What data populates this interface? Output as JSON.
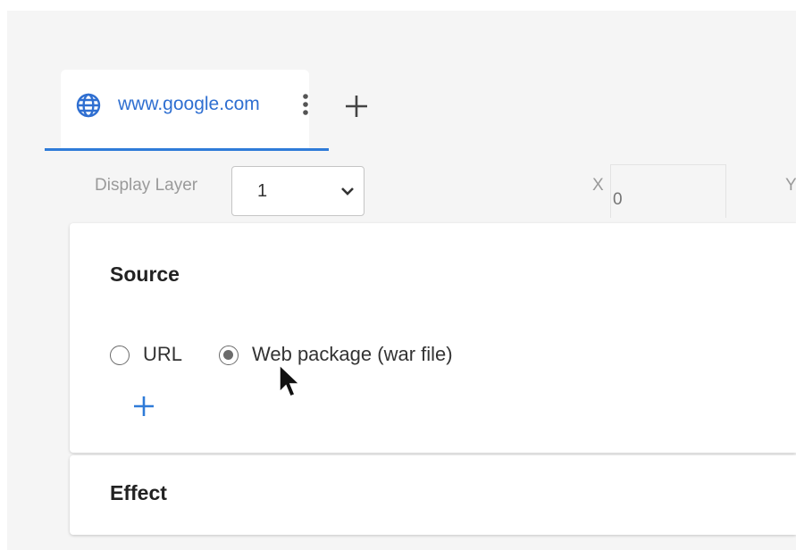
{
  "tab": {
    "label": "www.google.com",
    "icon": "globe-icon",
    "menu_icon": "kebab-menu-icon",
    "add_icon": "plus-icon",
    "accent_color": "#2f7bd8"
  },
  "toolbar": {
    "display_layer_label": "Display Layer",
    "display_layer_value": "1",
    "x_label": "X",
    "x_value": "",
    "x_placeholder": "0",
    "y_label": "Y"
  },
  "source": {
    "title": "Source",
    "options": [
      {
        "label": "URL",
        "selected": false
      },
      {
        "label": "Web package (war file)",
        "selected": true
      }
    ],
    "add_icon": "plus-icon",
    "add_icon_color": "#2f7bd8"
  },
  "effect": {
    "title": "Effect"
  }
}
